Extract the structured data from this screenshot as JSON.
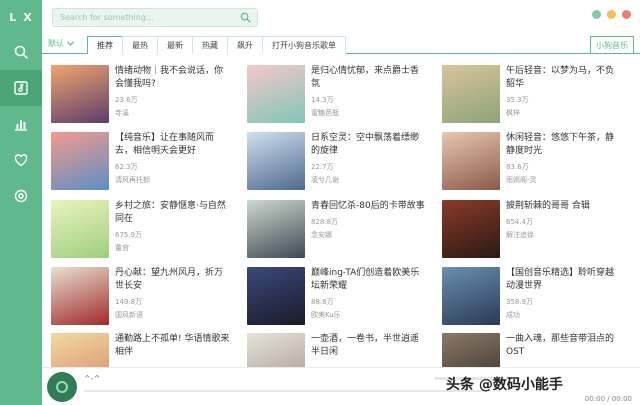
{
  "logo": {
    "letters": [
      "L",
      "X"
    ]
  },
  "sidebar": {
    "items": [
      {
        "name": "search-icon"
      },
      {
        "name": "music-list-icon",
        "active": true
      },
      {
        "name": "chart-icon"
      },
      {
        "name": "heart-icon"
      },
      {
        "name": "settings-icon"
      }
    ]
  },
  "search": {
    "placeholder": "Search for something..."
  },
  "window": {
    "colors": [
      "#85c9a6",
      "#f3c04f",
      "#f07b7b"
    ]
  },
  "tabs": {
    "source": "默认",
    "items": [
      "推荐",
      "最热",
      "最新",
      "热藏",
      "飙升",
      "打开小狗音乐歌单"
    ],
    "right": "小狗音乐"
  },
  "cards": [
    {
      "title": "情绪动物｜我不会说话，你会懂我吗?",
      "count": "23.6万",
      "author": "寺溪",
      "c1": "#f2a56b",
      "c2": "#5b3d6e"
    },
    {
      "title": "是归心情忧郁，来点爵士香氛",
      "count": "14.3万",
      "author": "蜜糖芭瓶",
      "c1": "#f6c7c9",
      "c2": "#7fc7b8"
    },
    {
      "title": "午后轻音：以梦为马，不负韶华",
      "count": "35.3万",
      "author": "枫梓",
      "c1": "#d9c49a",
      "c2": "#8da37a"
    },
    {
      "title": "【纯音乐】让在事随风而去，相信明天会更好",
      "count": "62.3万",
      "author": "清风再托额",
      "c1": "#f49a8c",
      "c2": "#5c8fc7"
    },
    {
      "title": "日系空灵：空中飘荡着缥缈的旋律",
      "count": "22.7万",
      "author": "凌兮几谢",
      "c1": "#cfe0ee",
      "c2": "#4f6a8f"
    },
    {
      "title": "休闲轻音：悠悠下午茶，静静度时光",
      "count": "63.6万",
      "author": "雨嫣阁-灵",
      "c1": "#e8c7b0",
      "c2": "#8b5a4a"
    },
    {
      "title": "乡村之旅：安静惬意·与自然同在",
      "count": "675.9万",
      "author": "董宫",
      "c1": "#e9f3c2",
      "c2": "#9fcf7a"
    },
    {
      "title": "青春回忆杀-80后的卡带故事",
      "count": "828.8万",
      "author": "念安娜",
      "c1": "#cfd8d0",
      "c2": "#3d4a52"
    },
    {
      "title": "披荆斩棘的哥哥 合辑",
      "count": "654.4万",
      "author": "解注追徐",
      "c1": "#8b3a2a",
      "c2": "#2a1a14"
    },
    {
      "title": "丹心献：望九州风月，折万世长安",
      "count": "149.8万",
      "author": "国风新语",
      "c1": "#e8e0d2",
      "c2": "#a12a2a"
    },
    {
      "title": "巅峰ing-TA们创造着欧美乐坛新荣耀",
      "count": "88.8万",
      "author": "欧美Ku乐",
      "c1": "#3a4a7a",
      "c2": "#1a1a2a"
    },
    {
      "title": "【国创音乐精选】聆听穿越动漫世界",
      "count": "358.9万",
      "author": "成功",
      "c1": "#6a8fb0",
      "c2": "#2a3a55"
    },
    {
      "title": "通勤路上不孤单! 华语情歌来相伴",
      "count": "",
      "author": "",
      "c1": "#f2d9a0",
      "c2": "#d98a6a"
    },
    {
      "title": "一壶酒，一卷书，半世逍遥半日闲",
      "count": "",
      "author": "",
      "c1": "#e6e2dc",
      "c2": "#a69a8a"
    },
    {
      "title": "一曲入魂，那些音带泪点的OST",
      "count": "",
      "author": "",
      "c1": "#8a7a6a",
      "c2": "#3a2e28"
    }
  ],
  "player": {
    "song": "^-^",
    "time": "00:00 / 00:00"
  },
  "watermark": "头条 @数码小能手"
}
